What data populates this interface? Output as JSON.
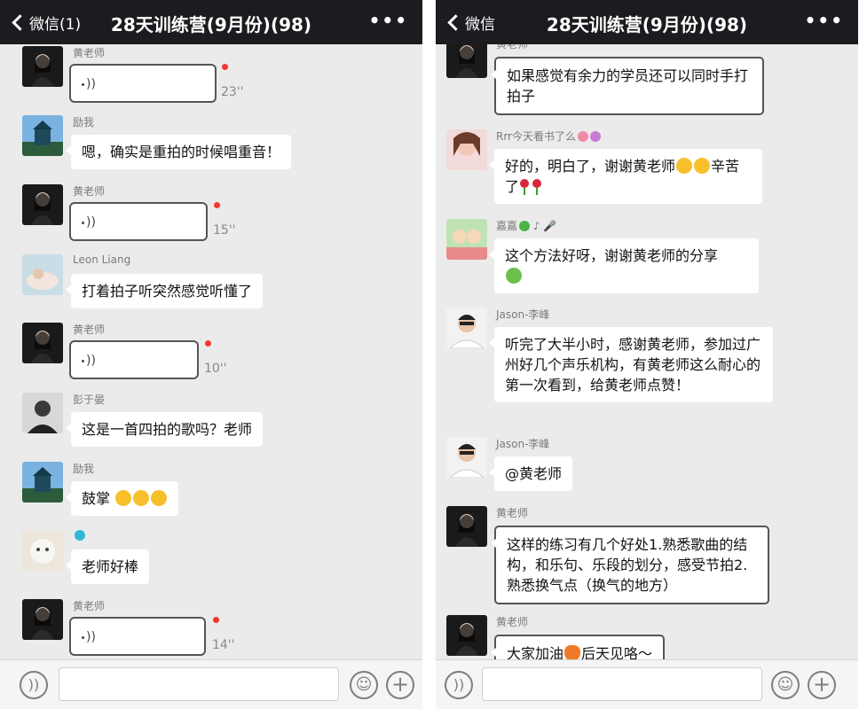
{
  "left": {
    "header": {
      "back_label": "微信(1)",
      "title": "28天训练营(9月份)(98)",
      "more": "•••"
    },
    "messages": [
      {
        "sender": "黄老师",
        "type": "voice",
        "duration": "23''"
      },
      {
        "sender": "励我",
        "type": "text",
        "text": "嗯，确实是重拍的时候唱重音！"
      },
      {
        "sender": "黄老师",
        "type": "voice",
        "duration": "15''"
      },
      {
        "sender": "Leon Liang",
        "type": "text",
        "text": "打着拍子听突然感觉听懂了"
      },
      {
        "sender": "黄老师",
        "type": "voice",
        "duration": "10''"
      },
      {
        "sender": "彭于晏",
        "type": "text",
        "text": "这是一首四拍的歌吗？老师"
      },
      {
        "sender": "励我",
        "type": "text",
        "text": "鼓掌"
      },
      {
        "sender": "",
        "type": "text",
        "text": "老师好棒"
      },
      {
        "sender": "黄老师",
        "type": "voice",
        "duration": "14''"
      }
    ]
  },
  "right": {
    "header": {
      "back_label": "微信",
      "title": "28天训练营(9月份)(98)",
      "more": "•••"
    },
    "messages": [
      {
        "sender": "黄老师",
        "type": "text",
        "text": "如果感觉有余力的学员还可以同时手打拍子"
      },
      {
        "sender": "Rrr今天看书了么",
        "type": "text",
        "text": "好的，明白了，谢谢黄老师",
        "text2": "辛苦了"
      },
      {
        "sender": "嘉嘉",
        "type": "text",
        "text": "这个方法好呀，谢谢黄老师的分享"
      },
      {
        "sender": "Jason-李峰",
        "type": "text",
        "text": "听完了大半小时，感谢黄老师，参加过广州好几个声乐机构，有黄老师这么耐心的第一次看到，给黄老师点赞！"
      },
      {
        "sender": "Jason-李峰",
        "type": "text",
        "text": "@黄老师"
      },
      {
        "sender": "黄老师",
        "type": "text",
        "text": "这样的练习有几个好处1.熟悉歌曲的结构，和乐句、乐段的划分，感受节拍2.熟悉换气点（换气的地方）"
      },
      {
        "sender": "黄老师",
        "type": "text",
        "text": "大家加油",
        "text2": "后天见咯～"
      }
    ]
  },
  "colors": {
    "header_bg": "#1c1c20",
    "chat_bg": "#ebebeb",
    "unread_dot": "#f43530"
  },
  "icons": {
    "back": "chevron-left-icon",
    "more": "more-dots-icon",
    "voice": "voice-wave-icon",
    "emoji": "emoji-icon",
    "plus": "plus-icon"
  }
}
